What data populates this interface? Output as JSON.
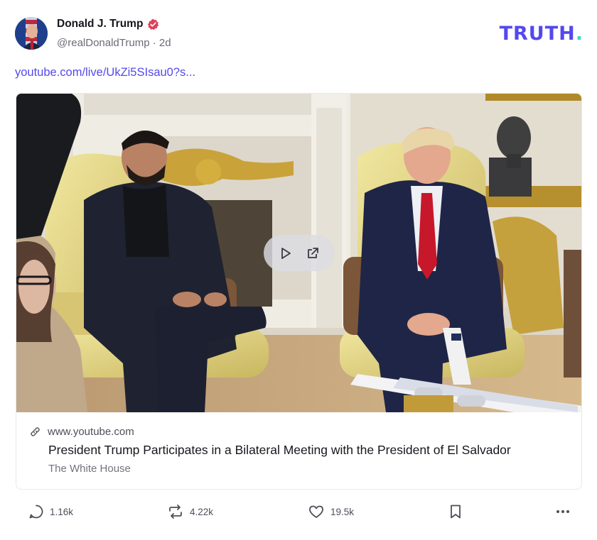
{
  "post": {
    "author_name": "Donald J. Trump",
    "handle": "@realDonaldTrump",
    "separator": "·",
    "time_ago": "2d",
    "link_text": "youtube.com/live/UkZi5SIsau0?s..."
  },
  "brand": {
    "logo_text": "TRUTH",
    "logo_dot": ".",
    "accent_color": "#5448ee",
    "dot_color": "#41d9c2",
    "verified_color": "#e0405a"
  },
  "link_card": {
    "domain": "www.youtube.com",
    "title": "President Trump Participates in a Bilateral Meeting with the President of El Salvador",
    "source": "The White House"
  },
  "actions": {
    "replies": "1.16k",
    "retruths": "4.22k",
    "likes": "19.5k"
  },
  "icons": [
    "verified-badge-icon",
    "play-icon",
    "external-link-icon",
    "link-icon",
    "reply-icon",
    "retruth-icon",
    "like-icon",
    "bookmark-icon",
    "more-icon"
  ]
}
